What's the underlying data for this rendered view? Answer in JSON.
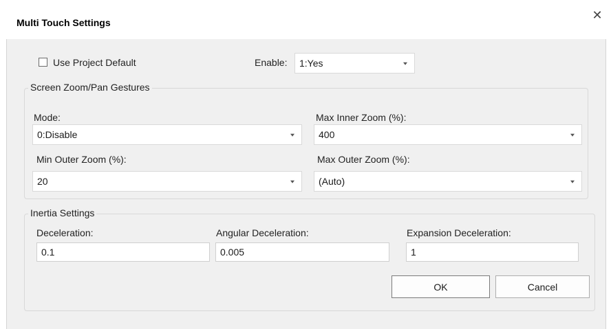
{
  "window": {
    "title": "Multi Touch Settings",
    "close_icon": "close-icon"
  },
  "top": {
    "use_project_default_label": "Use Project Default",
    "use_project_default_checked": false,
    "enable_label": "Enable:",
    "enable_value": "1:Yes"
  },
  "zoom_group": {
    "legend": "Screen Zoom/Pan Gestures",
    "mode_label": "Mode:",
    "mode_value": "0:Disable",
    "max_inner_label": "Max Inner Zoom (%):",
    "max_inner_value": "400",
    "min_outer_label": "Min Outer Zoom (%):",
    "min_outer_value": "20",
    "max_outer_label": "Max Outer Zoom (%):",
    "max_outer_value": "(Auto)"
  },
  "inertia_group": {
    "legend": "Inertia Settings",
    "deceleration_label": "Deceleration:",
    "deceleration_value": "0.1",
    "angular_label": "Angular Deceleration:",
    "angular_value": "0.005",
    "expansion_label": "Expansion Deceleration:",
    "expansion_value": "1"
  },
  "buttons": {
    "ok": "OK",
    "cancel": "Cancel"
  }
}
